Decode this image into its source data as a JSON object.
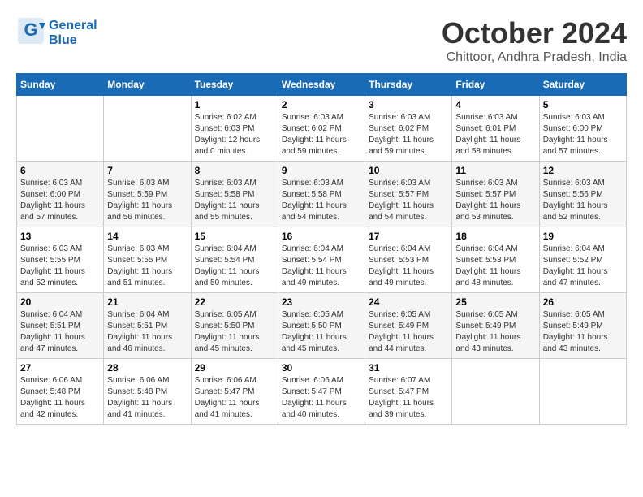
{
  "header": {
    "logo_line1": "General",
    "logo_line2": "Blue",
    "month": "October 2024",
    "location": "Chittoor, Andhra Pradesh, India"
  },
  "weekdays": [
    "Sunday",
    "Monday",
    "Tuesday",
    "Wednesday",
    "Thursday",
    "Friday",
    "Saturday"
  ],
  "weeks": [
    [
      {
        "day": "",
        "info": ""
      },
      {
        "day": "",
        "info": ""
      },
      {
        "day": "1",
        "info": "Sunrise: 6:02 AM\nSunset: 6:03 PM\nDaylight: 12 hours\nand 0 minutes."
      },
      {
        "day": "2",
        "info": "Sunrise: 6:03 AM\nSunset: 6:02 PM\nDaylight: 11 hours\nand 59 minutes."
      },
      {
        "day": "3",
        "info": "Sunrise: 6:03 AM\nSunset: 6:02 PM\nDaylight: 11 hours\nand 59 minutes."
      },
      {
        "day": "4",
        "info": "Sunrise: 6:03 AM\nSunset: 6:01 PM\nDaylight: 11 hours\nand 58 minutes."
      },
      {
        "day": "5",
        "info": "Sunrise: 6:03 AM\nSunset: 6:00 PM\nDaylight: 11 hours\nand 57 minutes."
      }
    ],
    [
      {
        "day": "6",
        "info": "Sunrise: 6:03 AM\nSunset: 6:00 PM\nDaylight: 11 hours\nand 57 minutes."
      },
      {
        "day": "7",
        "info": "Sunrise: 6:03 AM\nSunset: 5:59 PM\nDaylight: 11 hours\nand 56 minutes."
      },
      {
        "day": "8",
        "info": "Sunrise: 6:03 AM\nSunset: 5:58 PM\nDaylight: 11 hours\nand 55 minutes."
      },
      {
        "day": "9",
        "info": "Sunrise: 6:03 AM\nSunset: 5:58 PM\nDaylight: 11 hours\nand 54 minutes."
      },
      {
        "day": "10",
        "info": "Sunrise: 6:03 AM\nSunset: 5:57 PM\nDaylight: 11 hours\nand 54 minutes."
      },
      {
        "day": "11",
        "info": "Sunrise: 6:03 AM\nSunset: 5:57 PM\nDaylight: 11 hours\nand 53 minutes."
      },
      {
        "day": "12",
        "info": "Sunrise: 6:03 AM\nSunset: 5:56 PM\nDaylight: 11 hours\nand 52 minutes."
      }
    ],
    [
      {
        "day": "13",
        "info": "Sunrise: 6:03 AM\nSunset: 5:55 PM\nDaylight: 11 hours\nand 52 minutes."
      },
      {
        "day": "14",
        "info": "Sunrise: 6:03 AM\nSunset: 5:55 PM\nDaylight: 11 hours\nand 51 minutes."
      },
      {
        "day": "15",
        "info": "Sunrise: 6:04 AM\nSunset: 5:54 PM\nDaylight: 11 hours\nand 50 minutes."
      },
      {
        "day": "16",
        "info": "Sunrise: 6:04 AM\nSunset: 5:54 PM\nDaylight: 11 hours\nand 49 minutes."
      },
      {
        "day": "17",
        "info": "Sunrise: 6:04 AM\nSunset: 5:53 PM\nDaylight: 11 hours\nand 49 minutes."
      },
      {
        "day": "18",
        "info": "Sunrise: 6:04 AM\nSunset: 5:53 PM\nDaylight: 11 hours\nand 48 minutes."
      },
      {
        "day": "19",
        "info": "Sunrise: 6:04 AM\nSunset: 5:52 PM\nDaylight: 11 hours\nand 47 minutes."
      }
    ],
    [
      {
        "day": "20",
        "info": "Sunrise: 6:04 AM\nSunset: 5:51 PM\nDaylight: 11 hours\nand 47 minutes."
      },
      {
        "day": "21",
        "info": "Sunrise: 6:04 AM\nSunset: 5:51 PM\nDaylight: 11 hours\nand 46 minutes."
      },
      {
        "day": "22",
        "info": "Sunrise: 6:05 AM\nSunset: 5:50 PM\nDaylight: 11 hours\nand 45 minutes."
      },
      {
        "day": "23",
        "info": "Sunrise: 6:05 AM\nSunset: 5:50 PM\nDaylight: 11 hours\nand 45 minutes."
      },
      {
        "day": "24",
        "info": "Sunrise: 6:05 AM\nSunset: 5:49 PM\nDaylight: 11 hours\nand 44 minutes."
      },
      {
        "day": "25",
        "info": "Sunrise: 6:05 AM\nSunset: 5:49 PM\nDaylight: 11 hours\nand 43 minutes."
      },
      {
        "day": "26",
        "info": "Sunrise: 6:05 AM\nSunset: 5:49 PM\nDaylight: 11 hours\nand 43 minutes."
      }
    ],
    [
      {
        "day": "27",
        "info": "Sunrise: 6:06 AM\nSunset: 5:48 PM\nDaylight: 11 hours\nand 42 minutes."
      },
      {
        "day": "28",
        "info": "Sunrise: 6:06 AM\nSunset: 5:48 PM\nDaylight: 11 hours\nand 41 minutes."
      },
      {
        "day": "29",
        "info": "Sunrise: 6:06 AM\nSunset: 5:47 PM\nDaylight: 11 hours\nand 41 minutes."
      },
      {
        "day": "30",
        "info": "Sunrise: 6:06 AM\nSunset: 5:47 PM\nDaylight: 11 hours\nand 40 minutes."
      },
      {
        "day": "31",
        "info": "Sunrise: 6:07 AM\nSunset: 5:47 PM\nDaylight: 11 hours\nand 39 minutes."
      },
      {
        "day": "",
        "info": ""
      },
      {
        "day": "",
        "info": ""
      }
    ]
  ]
}
